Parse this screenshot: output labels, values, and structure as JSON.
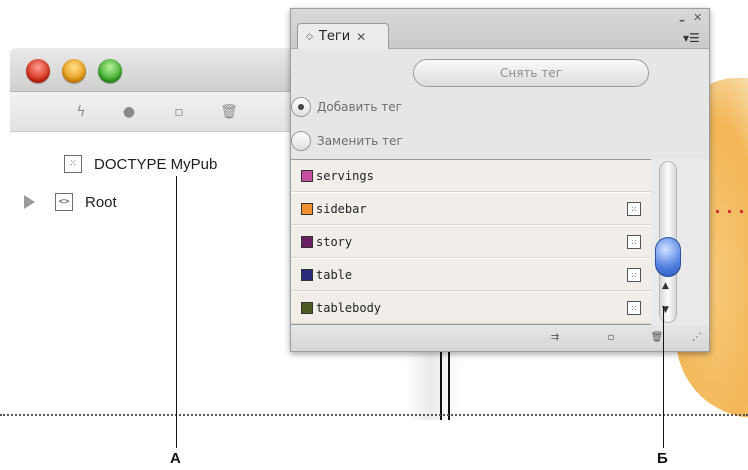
{
  "structure_pane": {
    "toolbar_icons": [
      "lightning-icon",
      "record-dot-icon",
      "new-element-icon",
      "trash-icon"
    ],
    "tree": [
      {
        "label": "DOCTYPE MyPub",
        "icon": "doctype-icon"
      },
      {
        "label": "Root",
        "icon": "element-icon"
      }
    ]
  },
  "tags_panel": {
    "tab_label": "Теги",
    "remove_tag_button": "Снять тег",
    "add_tag_option": "Добавить тег",
    "replace_tag_option": "Заменить тег",
    "tags": [
      {
        "name": "servings",
        "color": "#c44fa0"
      },
      {
        "name": "sidebar",
        "color": "#f1922e"
      },
      {
        "name": "story",
        "color": "#6a1f63"
      },
      {
        "name": "table",
        "color": "#2a2a7a"
      },
      {
        "name": "tablebody",
        "color": "#4a5a22"
      }
    ],
    "footer_icons": [
      "map-styles-icon",
      "new-tag-icon",
      "delete-tag-icon",
      "resize-grip-icon"
    ]
  },
  "callouts": {
    "a": "А",
    "b": "Б"
  }
}
